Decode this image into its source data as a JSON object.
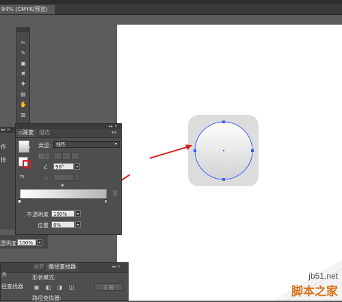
{
  "document_tab": {
    "title": "94% (CMYK/预览)",
    "close_glyph": "×"
  },
  "tools_panel": {
    "header_glyph": "▸▸ ×"
  },
  "left_fragment": {
    "items": [
      "作",
      "接"
    ]
  },
  "gradient_panel": {
    "header_controls": "▸▸ ×",
    "tabs": [
      {
        "label": "◇渐变"
      },
      {
        "label": "描边"
      }
    ],
    "type_label": "类型:",
    "type_value": "线性",
    "stroke_label": "描边",
    "angle_value": "90°",
    "opacity_label": "不透明度",
    "opacity_value": "100%",
    "position_label": "位置",
    "position_value": "0%",
    "menu_glyph": "▾≡"
  },
  "opacity_strip": {
    "label": "透明度",
    "value": "100%"
  },
  "pathfinder_panel": {
    "tabs": [
      {
        "label": "对齐"
      },
      {
        "label": "路径查找器"
      }
    ],
    "shape_modes_label": "形状模式:",
    "pathfinders_label": "路径查找器:",
    "expand_label": "扩展",
    "left_labels": [
      "齐",
      "径查找器"
    ],
    "header_controls": "◂◂ ×"
  },
  "watermark": {
    "site": "jb51.net",
    "brand": "脚本之家"
  },
  "colors": {
    "accent_blue": "#3a5cff",
    "arrow_red": "#d81e1e",
    "rounded_square": "#e0e0e0"
  }
}
